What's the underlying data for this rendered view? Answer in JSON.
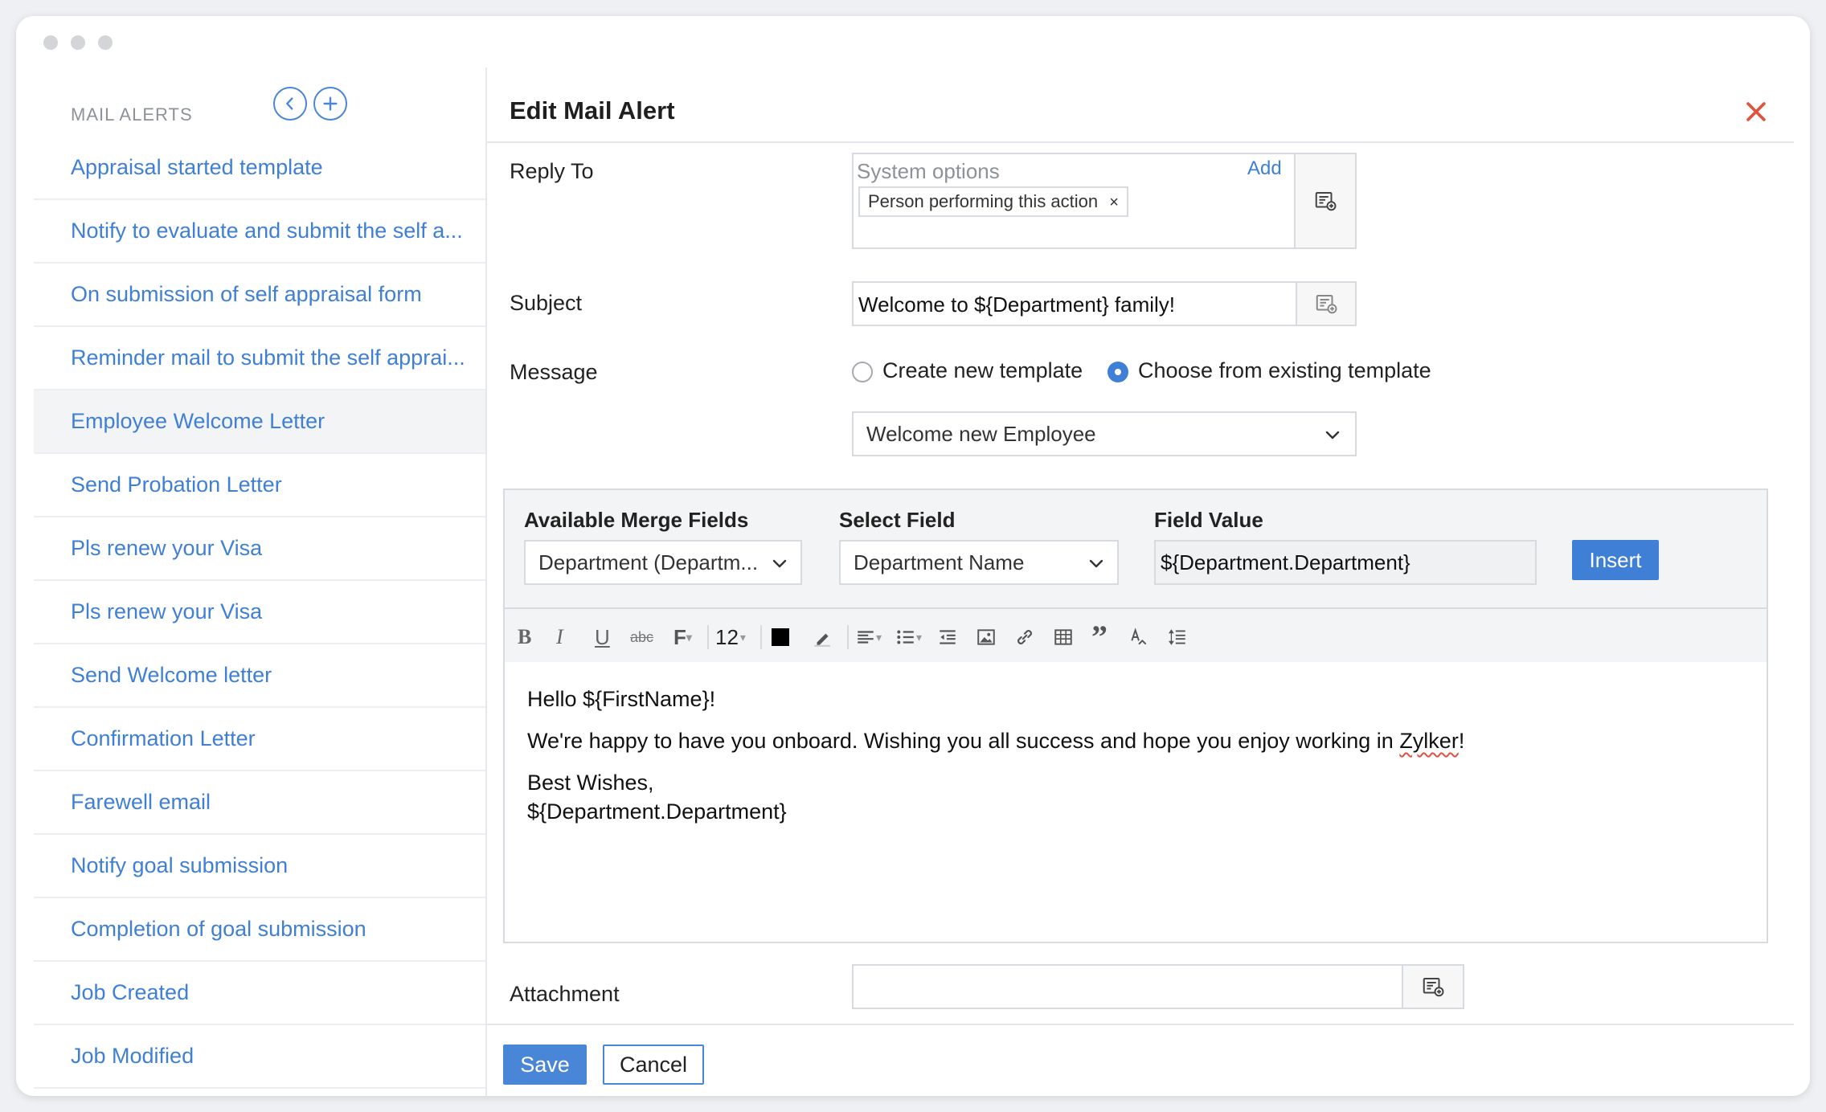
{
  "sidebar": {
    "title": "MAIL ALERTS",
    "items": [
      {
        "label": "Appraisal started template"
      },
      {
        "label": "Notify to evaluate and submit the self a..."
      },
      {
        "label": "On submission of self appraisal form"
      },
      {
        "label": "Reminder mail to submit the self apprai..."
      },
      {
        "label": "Employee Welcome Letter"
      },
      {
        "label": "Send Probation Letter"
      },
      {
        "label": "Pls renew your Visa"
      },
      {
        "label": "Pls renew your Visa"
      },
      {
        "label": "Send Welcome letter"
      },
      {
        "label": "Confirmation Letter"
      },
      {
        "label": "Farewell email"
      },
      {
        "label": "Notify goal submission"
      },
      {
        "label": "Completion of goal submission"
      },
      {
        "label": "Job Created"
      },
      {
        "label": "Job Modified"
      }
    ],
    "active_item": "Employee Welcome Letter"
  },
  "panel": {
    "title": "Edit Mail Alert",
    "reply_to": {
      "label": "Reply To",
      "placeholder": "System options",
      "add_link": "Add",
      "chip": "Person performing this action"
    },
    "subject": {
      "label": "Subject",
      "value": "Welcome to ${Department} family!"
    },
    "message": {
      "label": "Message",
      "option_new": "Create new template",
      "option_existing": "Choose from existing template",
      "selected_option": "Choose from existing template",
      "template_value": "Welcome new Employee"
    },
    "merge": {
      "available_label": "Available Merge Fields",
      "available_value": "Department (Departm...",
      "select_field_label": "Select Field",
      "select_field_value": "Department Name",
      "field_value_label": "Field Value",
      "field_value": "${Department.Department}",
      "insert_label": "Insert"
    },
    "toolbar": {
      "font_size": "12",
      "text_color": "#000000"
    },
    "editor": {
      "line1": "Hello ${FirstName}!",
      "line2_a": "We're happy to have you onboard. Wishing you all success and hope you enjoy working in ",
      "line2_word": "Zylker",
      "line2_b": "!",
      "line3": "Best Wishes,",
      "line4": "${Department.Department}"
    },
    "attachment": {
      "label": "Attachment"
    },
    "save_label": "Save",
    "cancel_label": "Cancel"
  },
  "colors": {
    "accent": "#3f7fd6",
    "close": "#e0533d"
  }
}
